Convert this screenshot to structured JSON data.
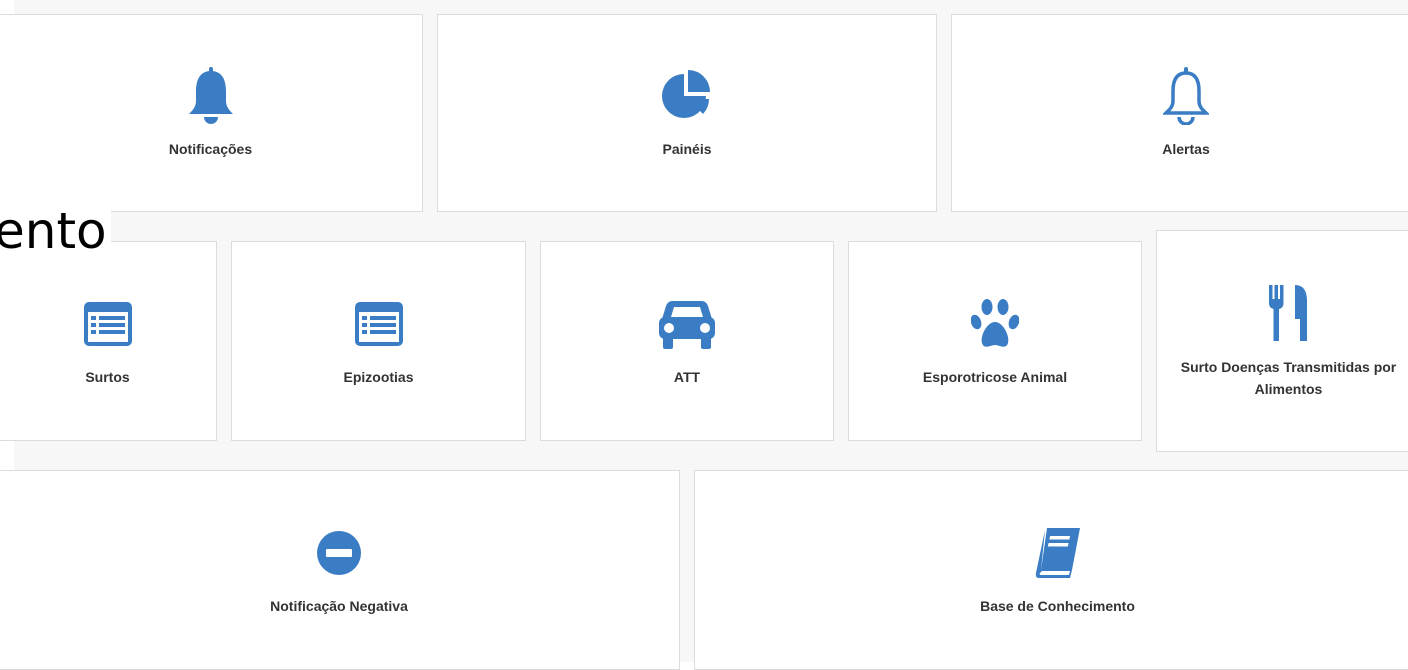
{
  "overlay": {
    "text": "ento"
  },
  "colors": {
    "icon": "#3a7dc4",
    "card_border": "#dcdcdc",
    "background": "#f7f7f7",
    "label": "#333333"
  },
  "cards": {
    "notificacoes": {
      "label": "Notificações",
      "icon": "bell-solid-icon"
    },
    "paineis": {
      "label": "Painéis",
      "icon": "pie-chart-icon"
    },
    "alertas": {
      "label": "Alertas",
      "icon": "bell-outline-icon"
    },
    "surtos": {
      "label": "Surtos",
      "icon": "list-icon"
    },
    "epizootias": {
      "label": "Epizootias",
      "icon": "list-icon"
    },
    "att": {
      "label": "ATT",
      "icon": "car-icon"
    },
    "esporotricose": {
      "label": "Esporotricose Animal",
      "icon": "paw-icon"
    },
    "surto_dta": {
      "label": "Surto Doenças Transmitidas por Alimentos",
      "icon": "cutlery-icon"
    },
    "notificacao_negativa": {
      "label": "Notificação Negativa",
      "icon": "minus-circle-icon"
    },
    "base_conhecimento": {
      "label": "Base de Conhecimento",
      "icon": "book-icon"
    }
  }
}
